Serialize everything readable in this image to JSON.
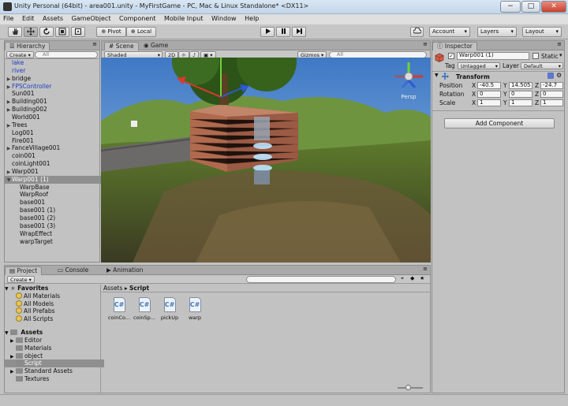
{
  "window": {
    "title": "Unity Personal (64bit) - area001.unity - MyFirstGame - PC, Mac & Linux Standalone* <DX11>",
    "minimize": "−",
    "maximize": "□",
    "close": "✕"
  },
  "menu": [
    "File",
    "Edit",
    "Assets",
    "GameObject",
    "Component",
    "Mobile Input",
    "Window",
    "Help"
  ],
  "toolbar": {
    "pivot": "Pivot",
    "local": "Local",
    "account": "Account",
    "layers": "Layers",
    "layout": "Layout",
    "play_icon": "play-icon",
    "pause_icon": "pause-icon",
    "step_icon": "step-icon"
  },
  "hierarchy": {
    "tab": "Hierarchy",
    "create": "Create",
    "search_placeholder": "All",
    "items": [
      {
        "label": "lake",
        "indent": 0,
        "arrow": false,
        "style": "blue"
      },
      {
        "label": "river",
        "indent": 0,
        "arrow": false,
        "style": "blue"
      },
      {
        "label": "bridge",
        "indent": 0,
        "arrow": true,
        "style": ""
      },
      {
        "label": "FPSController",
        "indent": 0,
        "arrow": true,
        "style": "blue"
      },
      {
        "label": "Sun001",
        "indent": 0,
        "arrow": false,
        "style": ""
      },
      {
        "label": "Building001",
        "indent": 0,
        "arrow": true,
        "style": ""
      },
      {
        "label": "Building002",
        "indent": 0,
        "arrow": true,
        "style": ""
      },
      {
        "label": "World001",
        "indent": 0,
        "arrow": false,
        "style": ""
      },
      {
        "label": "Trees",
        "indent": 0,
        "arrow": true,
        "style": ""
      },
      {
        "label": "Log001",
        "indent": 0,
        "arrow": false,
        "style": ""
      },
      {
        "label": "Fire001",
        "indent": 0,
        "arrow": false,
        "style": ""
      },
      {
        "label": "FanceVillage001",
        "indent": 0,
        "arrow": true,
        "style": ""
      },
      {
        "label": "coin001",
        "indent": 0,
        "arrow": false,
        "style": ""
      },
      {
        "label": "coinLight001",
        "indent": 0,
        "arrow": false,
        "style": ""
      },
      {
        "label": "Warp001",
        "indent": 0,
        "arrow": true,
        "style": ""
      },
      {
        "label": "Warp001 (1)",
        "indent": 0,
        "arrow": true,
        "style": "sel"
      },
      {
        "label": "WarpBase",
        "indent": 1,
        "arrow": false,
        "style": ""
      },
      {
        "label": "WarpRoof",
        "indent": 1,
        "arrow": false,
        "style": ""
      },
      {
        "label": "base001",
        "indent": 1,
        "arrow": false,
        "style": ""
      },
      {
        "label": "base001 (1)",
        "indent": 1,
        "arrow": false,
        "style": ""
      },
      {
        "label": "base001 (2)",
        "indent": 1,
        "arrow": false,
        "style": ""
      },
      {
        "label": "base001 (3)",
        "indent": 1,
        "arrow": false,
        "style": ""
      },
      {
        "label": "WrapEffect",
        "indent": 1,
        "arrow": false,
        "style": ""
      },
      {
        "label": "warpTarget",
        "indent": 1,
        "arrow": false,
        "style": ""
      }
    ]
  },
  "scene": {
    "tab_scene": "Scene",
    "tab_game": "Game",
    "shading": "Shaded",
    "mode_2d": "2D",
    "gizmos": "Gizmos",
    "search_placeholder": "All",
    "persp": "Persp"
  },
  "inspector": {
    "tab": "Inspector",
    "object_name": "Warp001 (1)",
    "static_label": "Static",
    "tag_label": "Tag",
    "tag_value": "Untagged",
    "layer_label": "Layer",
    "layer_value": "Default",
    "transform_title": "Transform",
    "position_label": "Position",
    "rotation_label": "Rotation",
    "scale_label": "Scale",
    "position": {
      "x": "-40.5",
      "y": "14.505",
      "z": "-24.7"
    },
    "rotation": {
      "x": "0",
      "y": "0",
      "z": "0"
    },
    "scale": {
      "x": "1",
      "y": "1",
      "z": "1"
    },
    "add_component": "Add Component"
  },
  "project": {
    "tab_project": "Project",
    "tab_console": "Console",
    "tab_animation": "Animation",
    "create": "Create",
    "favorites_label": "Favorites",
    "favorites": [
      "All Materials",
      "All Models",
      "All Prefabs",
      "All Scripts"
    ],
    "assets_label": "Assets",
    "folders": [
      {
        "label": "Editor",
        "arrow": true,
        "sel": false
      },
      {
        "label": "Materials",
        "arrow": false,
        "sel": false
      },
      {
        "label": "object",
        "arrow": true,
        "sel": false
      },
      {
        "label": "Script",
        "arrow": false,
        "sel": true
      },
      {
        "label": "Standard Assets",
        "arrow": true,
        "sel": false
      },
      {
        "label": "Textures",
        "arrow": false,
        "sel": false
      }
    ],
    "breadcrumb_root": "Assets",
    "breadcrumb_sep": "▸",
    "breadcrumb_current": "Script",
    "scripts": [
      "coinCo...",
      "coinSp...",
      "pickUp",
      "warp"
    ]
  }
}
